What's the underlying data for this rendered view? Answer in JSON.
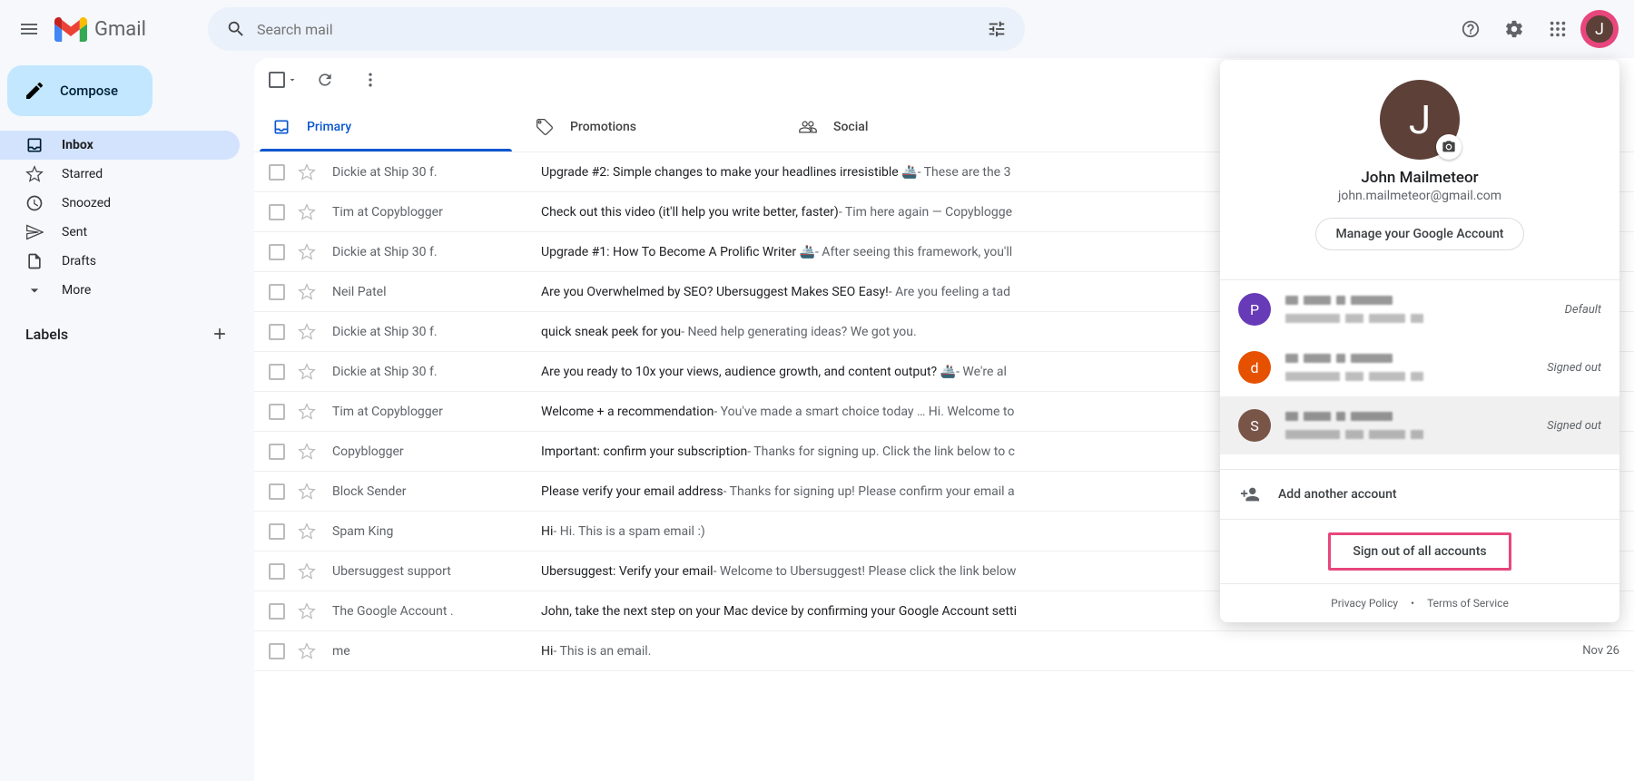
{
  "header": {
    "logo_text": "Gmail",
    "search_placeholder": "Search mail",
    "avatar_letter": "J"
  },
  "sidebar": {
    "compose": "Compose",
    "items": [
      {
        "label": "Inbox"
      },
      {
        "label": "Starred"
      },
      {
        "label": "Snoozed"
      },
      {
        "label": "Sent"
      },
      {
        "label": "Drafts"
      },
      {
        "label": "More"
      }
    ],
    "labels_title": "Labels"
  },
  "tabs": [
    {
      "label": "Primary"
    },
    {
      "label": "Promotions"
    },
    {
      "label": "Social"
    }
  ],
  "emails": [
    {
      "sender": "Dickie at Ship 30 f.",
      "subject": "Upgrade #2: Simple changes to make your headlines irresistible 🚢",
      "snippet": " - These are the 3",
      "date": ""
    },
    {
      "sender": "Tim at Copyblogger",
      "subject": "Check out this video (it'll help you write better, faster)",
      "snippet": " - Tim here again — Copyblogge",
      "date": ""
    },
    {
      "sender": "Dickie at Ship 30 f.",
      "subject": "Upgrade #1: How To Become A Prolific Writer 🚢",
      "snippet": " - After seeing this framework, you'll",
      "date": ""
    },
    {
      "sender": "Neil Patel",
      "subject": "Are you Overwhelmed by SEO? Ubersuggest Makes SEO Easy!",
      "snippet": " - Are you feeling a tad",
      "date": ""
    },
    {
      "sender": "Dickie at Ship 30 f.",
      "subject": "quick sneak peek for you",
      "snippet": " - Need help generating ideas? We got you.",
      "date": ""
    },
    {
      "sender": "Dickie at Ship 30 f.",
      "subject": "Are you ready to 10x your views, audience growth, and content output? 🚢",
      "snippet": " - We're al",
      "date": ""
    },
    {
      "sender": "Tim at Copyblogger",
      "subject": "Welcome + a recommendation",
      "snippet": " - You've made a smart choice today … Hi. Welcome to",
      "date": ""
    },
    {
      "sender": "Copyblogger",
      "subject": "Important: confirm your subscription",
      "snippet": " - Thanks for signing up. Click the link below to c",
      "date": ""
    },
    {
      "sender": "Block Sender",
      "subject": "Please verify your email address",
      "snippet": " - Thanks for signing up! Please confirm your email a",
      "date": ""
    },
    {
      "sender": "Spam King",
      "subject": "Hi",
      "snippet": " - Hi. This is a spam email :)",
      "date": ""
    },
    {
      "sender": "Ubersuggest support",
      "subject": "Ubersuggest: Verify your email",
      "snippet": " - Welcome to Ubersuggest! Please click the link below",
      "date": ""
    },
    {
      "sender": "The Google Account .",
      "subject": "John, take the next step on your Mac device by confirming your Google Account setti",
      "snippet": "",
      "date": ""
    },
    {
      "sender": "me",
      "subject": "Hi",
      "snippet": " - This is an email.",
      "date": "Nov 26"
    }
  ],
  "popup": {
    "avatar_letter": "J",
    "name": "John Mailmeteor",
    "email": "john.mailmeteor@gmail.com",
    "manage": "Manage your Google Account",
    "accounts": [
      {
        "letter": "P",
        "color": "#673ab7",
        "status": "Default"
      },
      {
        "letter": "d",
        "color": "#e65100",
        "status": "Signed out"
      },
      {
        "letter": "S",
        "color": "#795548",
        "status": "Signed out"
      }
    ],
    "add_account": "Add another account",
    "signout": "Sign out of all accounts",
    "privacy": "Privacy Policy",
    "dot": "•",
    "terms": "Terms of Service"
  }
}
